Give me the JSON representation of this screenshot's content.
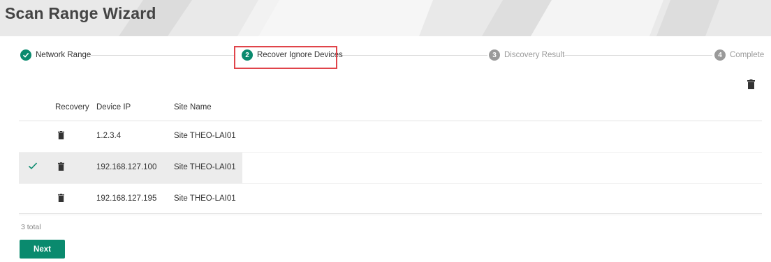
{
  "header": {
    "title": "Scan Range Wizard"
  },
  "steps": [
    {
      "number": "",
      "label": "Network Range",
      "state": "done"
    },
    {
      "number": "2",
      "label": "Recover Ignore Devices",
      "state": "active"
    },
    {
      "number": "3",
      "label": "Discovery Result",
      "state": "inactive"
    },
    {
      "number": "4",
      "label": "Complete",
      "state": "inactive"
    }
  ],
  "table": {
    "columns": {
      "recovery": "Recovery",
      "device_ip": "Device IP",
      "site_name": "Site Name"
    },
    "rows": [
      {
        "device_ip": "1.2.3.4",
        "site_name": "Site THEO-LAI01",
        "checked": false
      },
      {
        "device_ip": "192.168.127.100",
        "site_name": "Site THEO-LAI01",
        "checked": true
      },
      {
        "device_ip": "192.168.127.195",
        "site_name": "Site THEO-LAI01",
        "checked": false
      }
    ],
    "total_label": "3 total"
  },
  "footer": {
    "next_label": "Next"
  },
  "colors": {
    "accent": "#0a8a6e",
    "highlight": "#e0444a",
    "inactive": "#9a9a9a"
  },
  "icons": {
    "step_done": "check-circle-icon",
    "delete": "trash-icon",
    "checked": "check-icon"
  }
}
